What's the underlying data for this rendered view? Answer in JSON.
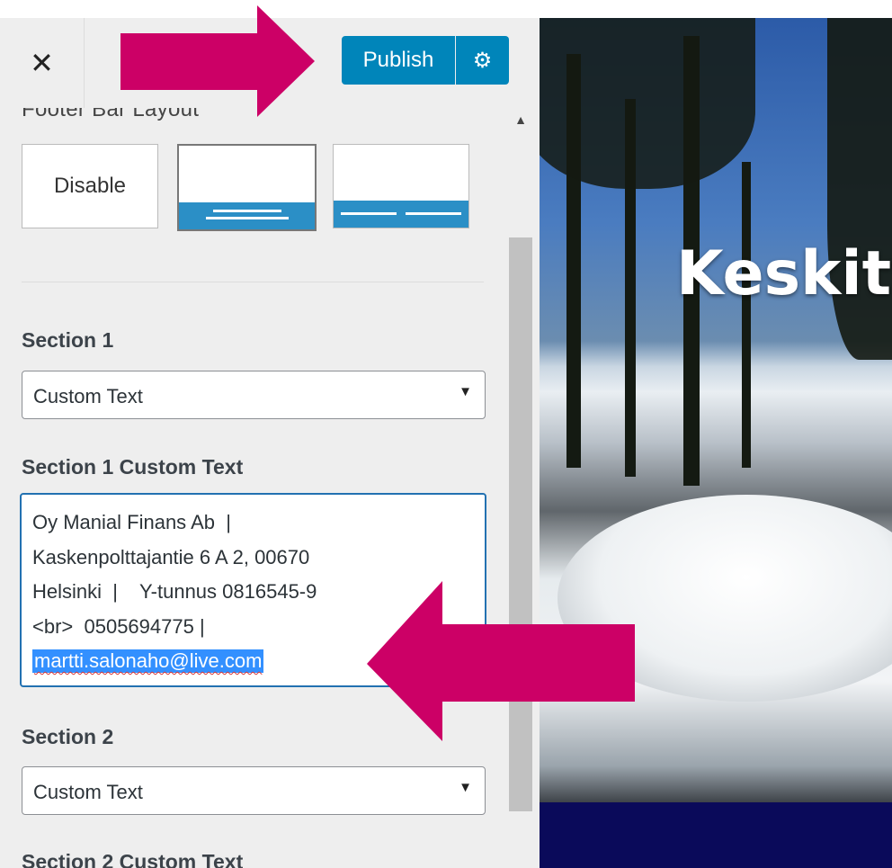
{
  "topbar": {
    "close_glyph": "✕",
    "publish_label": "Publish",
    "settings_icon": "gear-icon",
    "settings_glyph": "⚙"
  },
  "panel": {
    "section_heading_cut": "Footer Bar Layout",
    "layout_options": {
      "disable_label": "Disable"
    },
    "section1": {
      "label": "Section 1",
      "select_value": "Custom Text",
      "custom_text_label": "Section 1 Custom Text",
      "custom_text_lines": [
        "Oy Manial Finans Ab  |",
        "Kaskenpolttajantie 6 A 2, 00670",
        "Helsinki  |    Y-tunnus 0816545-9",
        "<br>  0505694775 |",
        "martti.salonaho@live.com"
      ]
    },
    "section2": {
      "label": "Section 2",
      "select_value": "Custom Text",
      "custom_text_label": "Section 2 Custom Text"
    },
    "select_arrow_glyph": "▼",
    "scroll_up_glyph": "▲"
  },
  "preview": {
    "hero_text": "Keskity"
  },
  "colors": {
    "publish_blue": "#0085ba",
    "focus_border": "#2271b1",
    "selection": "#3390ff",
    "arrow_magenta": "#cc0066",
    "footer_navy": "#0a0a5a"
  }
}
